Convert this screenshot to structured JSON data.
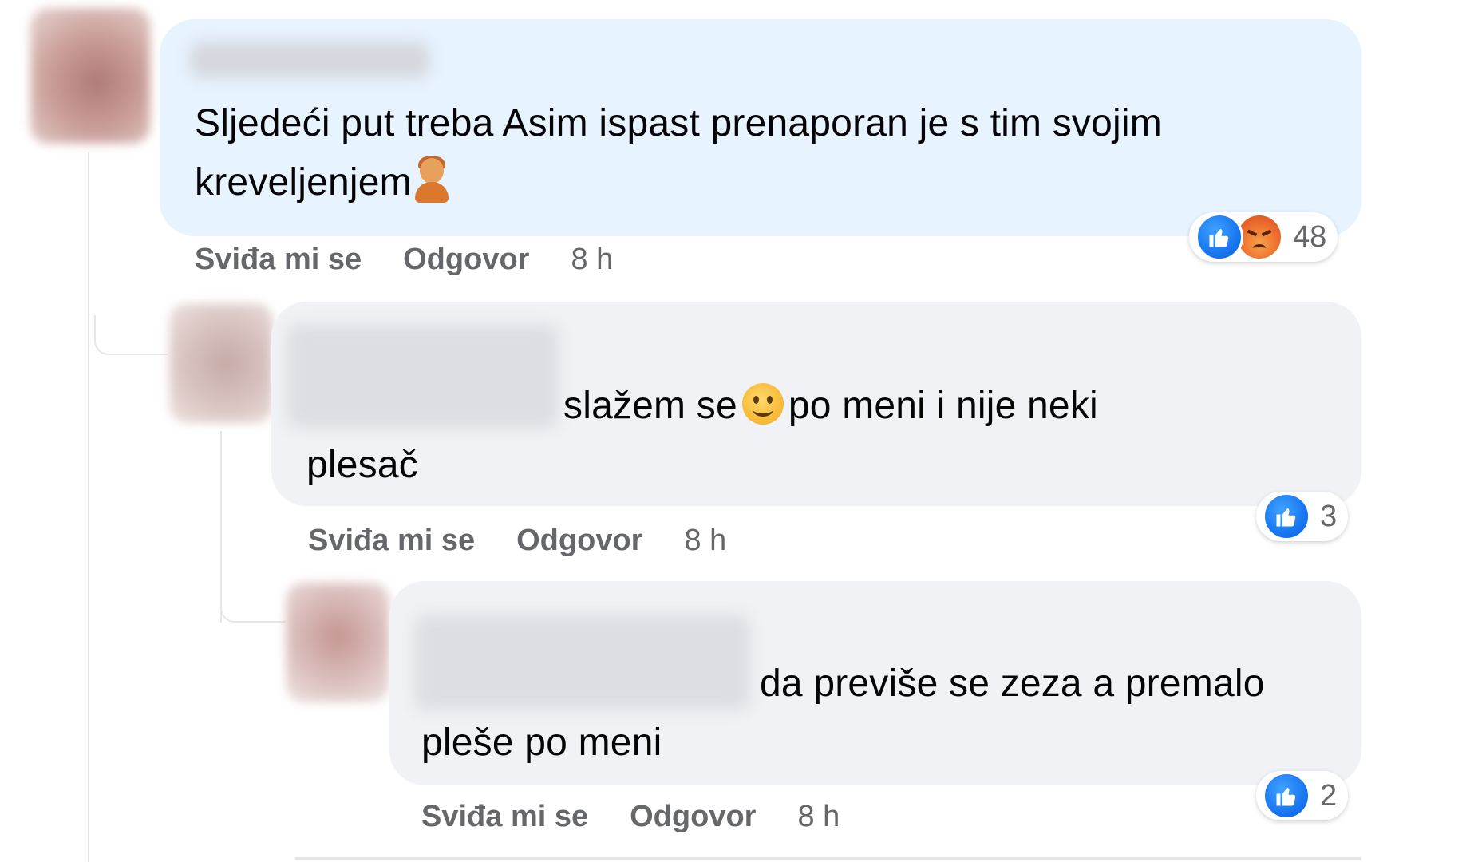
{
  "comments": [
    {
      "text_line1": "Sljedeći put treba Asim ispast prenaporan je s tim svojim",
      "text_line2": "kreveljenjem",
      "emoji": "person-facepalm-emoji",
      "reaction_count": "48",
      "reactions": [
        "like-icon",
        "angry-icon"
      ],
      "like_label": "Sviđa mi se",
      "reply_label": "Odgovor",
      "time": "8 h"
    },
    {
      "text_line1": "slažem se",
      "text_line1_after_emoji": "po meni i nije neki",
      "text_line2": "plesač",
      "emoji": "smiling-face-emoji",
      "reaction_count": "3",
      "reactions": [
        "like-icon"
      ],
      "like_label": "Sviđa mi se",
      "reply_label": "Odgovor",
      "time": "8 h"
    },
    {
      "text_line1": "da previše se zeza a premalo",
      "text_line2": "pleše po meni",
      "reaction_count": "2",
      "reactions": [
        "like-icon"
      ],
      "like_label": "Sviđa mi se",
      "reply_label": "Odgovor",
      "time": "8 h"
    }
  ],
  "colors": {
    "highlight_bubble": "#e7f3ff",
    "normal_bubble": "#f0f2f5",
    "like_blue": "#1877f2",
    "angry_orange": "#ec6d2d",
    "meta_text": "#65676b"
  }
}
